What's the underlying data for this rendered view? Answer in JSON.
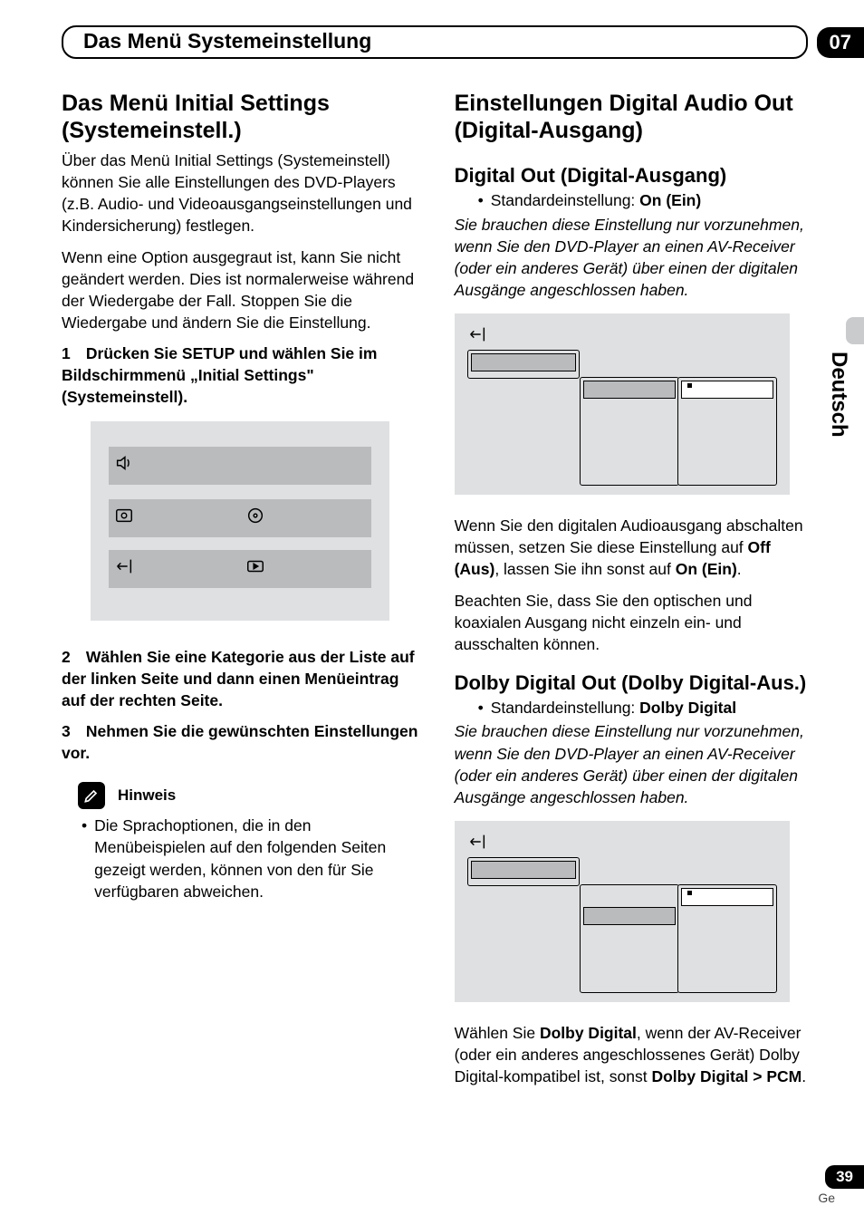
{
  "header": {
    "section_title": "Das Menü Systemeinstellung",
    "chapter_number": "07"
  },
  "side": {
    "language": "Deutsch"
  },
  "footer": {
    "page_number": "39",
    "lang_code": "Ge"
  },
  "left": {
    "h1": "Das Menü Initial Settings (Systemeinstell.)",
    "p1": "Über das Menü Initial Settings (Systemeinstell) können Sie alle Einstellungen des DVD-Players (z.B. Audio- und Videoausgangseinstellungen und Kindersicherung) festlegen.",
    "p2": "Wenn eine Option ausgegraut ist, kann Sie nicht geändert werden. Dies ist normalerweise während der Wiedergabe der Fall. Stoppen Sie die Wiedergabe und ändern Sie die Einstellung.",
    "step1_num": "1",
    "step1_text": "Drücken Sie SETUP und wählen Sie im Bildschirmmenü „Initial Settings\" (Systemeinstell).",
    "step2_num": "2",
    "step2_text": "Wählen Sie eine Kategorie aus der Liste auf der linken Seite und dann einen Menüeintrag auf der rechten Seite.",
    "step3_num": "3",
    "step3_text": "Nehmen Sie die gewünschten Einstellungen vor.",
    "note_heading": "Hinweis",
    "note_text": "Die Sprachoptionen, die in den Menübeispielen auf den folgenden Seiten gezeigt werden, können von den für Sie verfügbaren abweichen.",
    "icons": {
      "row1": "audio-icon",
      "row2a": "video-icon",
      "row2b": "disc-icon",
      "row3a": "settings-icon",
      "row3b": "play-icon"
    }
  },
  "right": {
    "h1": "Einstellungen Digital Audio Out (Digital-Ausgang)",
    "section1": {
      "h2": "Digital Out (Digital-Ausgang)",
      "default_label": "Standardeinstellung: ",
      "default_value": "On (Ein)",
      "italic_note": "Sie brauchen diese Einstellung nur vorzunehmen, wenn Sie den DVD-Player an einen AV-Receiver (oder ein anderes Gerät) über einen der digitalen Ausgänge angeschlossen haben.",
      "p_after_fig_1a": "Wenn Sie den digitalen Audioausgang abschalten müssen, setzen Sie diese Einstellung auf ",
      "p_after_fig_1b": "Off (Aus)",
      "p_after_fig_1c": ", lassen Sie ihn sonst auf ",
      "p_after_fig_1d": "On (Ein)",
      "p_after_fig_1e": ".",
      "p_after_fig_2": "Beachten Sie, dass Sie den optischen und koaxialen Ausgang nicht einzeln ein- und ausschalten können."
    },
    "section2": {
      "h2": "Dolby Digital Out (Dolby Digital-Aus.)",
      "default_label": "Standardeinstellung: ",
      "default_value": "Dolby Digital",
      "italic_note": "Sie brauchen diese Einstellung nur vorzunehmen, wenn Sie den DVD-Player an einen AV-Receiver (oder ein anderes Gerät) über einen der digitalen Ausgänge angeschlossen haben.",
      "p_after_a": "Wählen Sie ",
      "p_after_b": "Dolby Digital",
      "p_after_c": ", wenn der AV-Receiver (oder ein anderes angeschlossenes Gerät) Dolby Digital-kompatibel ist, sonst ",
      "p_after_d": "Dolby Digital > PCM",
      "p_after_e": "."
    }
  }
}
